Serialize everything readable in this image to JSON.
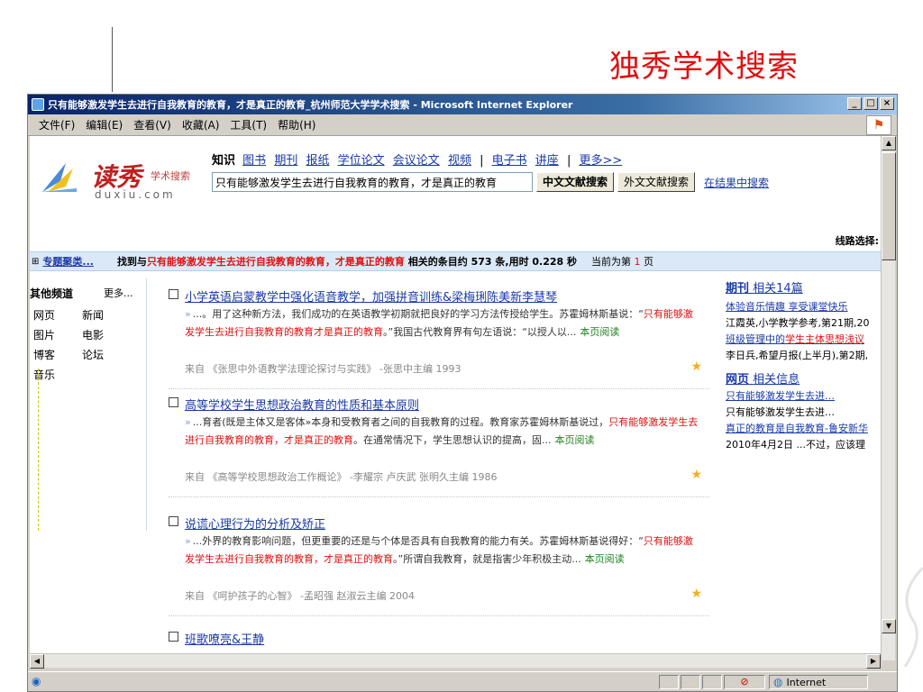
{
  "slide": {
    "title": "独秀学术搜索"
  },
  "window": {
    "title": "只有能够激发学生去进行自我教育的教育，才是真正的教育_杭州师范大学学术搜索 - Microsoft Internet Explorer",
    "controls": [
      "_",
      "□",
      "×"
    ],
    "menu": [
      "文件(F)",
      "编辑(E)",
      "查看(V)",
      "收藏(A)",
      "工具(T)",
      "帮助(H)"
    ],
    "status": {
      "zone": "Internet"
    }
  },
  "logo": {
    "name": "读秀",
    "sub": "学术搜索",
    "url": "duxiu.com"
  },
  "channels": {
    "current": "知识",
    "items": [
      "图书",
      "期刊",
      "报纸",
      "学位论文",
      "会议论文",
      "视频"
    ],
    "items2": [
      "电子书",
      "讲座"
    ],
    "more": "更多>>",
    "sep": "|"
  },
  "search": {
    "value": "只有能够激发学生去进行自我教育的教育，才是真正的教育",
    "btn_cn": "中文文献搜索",
    "btn_foreign": "外文文献搜索",
    "in_results": "在结果中搜索"
  },
  "route_label": "线路选择:",
  "resultbar": {
    "topic": "专题聚类...",
    "found_prefix": "找到与",
    "keyword": "只有能够激发学生去进行自我教育的教育，才是真正的教育",
    "found_suffix": " 相关的条目约 573 条,用时 0.228 秒",
    "page_prefix": "当前为第 ",
    "page_num": "1",
    "page_suffix": " 页"
  },
  "leftnav": {
    "heading": "其他频道",
    "more": "更多...",
    "items": [
      "网页",
      "新闻",
      "图片",
      "电影",
      "博客",
      "论坛",
      "音乐"
    ]
  },
  "results": [
    {
      "title": "小学英语启蒙教学中强化语音教学，加强拼音训练&梁梅琍陈美新李慧琴",
      "text1": "...。用了这种新方法，我们成功的在英语教学初期就把良好的学习方法传授给学生。苏霍姆林斯基说：“",
      "hl1": "只有能够激发学生去进行自我教育的教育才是真正的教育",
      "text2": "。”我国古代教育界有句左语说：“以授人以...",
      "read": "本页阅读",
      "source": "来自 《张思中外语教学法理论探讨与实践》 -张思中主编 1993"
    },
    {
      "title": "高等学校学生思想政治教育的性质和基本原则",
      "text0": "...育者(既是主体又是客体»本身和受教育者之间的自我教育的过程。教育家苏霍姆林斯基说过，",
      "hl1": "只有能够激发学生去进行自我教育的教育，才是真正的教育",
      "text2": "。在通常情况下，学生思想认识的提高，固...",
      "read": "本页阅读",
      "source": "来自 《高等学校思想政治工作概论》 -李耀宗 卢庆武 张明久主编 1986"
    },
    {
      "title": "说谎心理行为的分析及矫正",
      "text1": "...外界的教育影响问题，但更重要的还是与个体是否具有自我教育的能力有关。苏霍姆林斯基说得好：“",
      "hl1": "只有能够激发学生去进行自我教育的教育，才是真正的教育",
      "text2": "。”所谓自我教育，就是指害少年积极主动...",
      "read": "本页阅读",
      "source": "来自 《呵护孩子的心智》 -孟昭强 赵淑云主编 2004"
    },
    {
      "title": "班歌嘹亮&王静"
    }
  ],
  "right": {
    "journal_head": "期刊",
    "journal_count": "相关14篇",
    "j1": "体验音乐情趣 享受课堂快乐",
    "j1src": "江霞英,小学教学参考,第21期,20",
    "j2a": "班级管理中的",
    "j2b": "学生主体思想浅议",
    "j2src": "李日兵,希望月报(上半月),第2期,",
    "web_head": "网页",
    "web_count": "相关信息",
    "w1": "只有能够激发学生去进…",
    "w1b": "只有能够激发学生去进…",
    "w2": "真正的教育是自我教育-鲁安新华",
    "w2src": "2010年4月2日 ...不过，应该理"
  },
  "colors": {
    "accent": "#e01010",
    "link": "#1a3aa8",
    "titlebar": "#0a246a"
  }
}
